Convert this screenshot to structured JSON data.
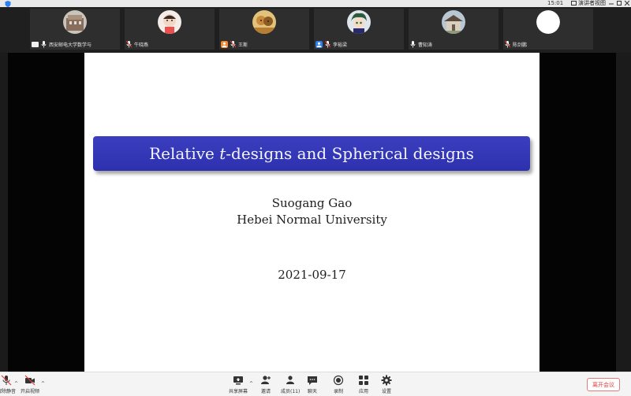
{
  "window": {
    "time": "15:01",
    "view_label": "演讲者视图"
  },
  "participants": [
    {
      "name": "西安邮电大学数学与",
      "mic": "on",
      "icon": "screen-share-icon"
    },
    {
      "name": "牛晓燕",
      "mic": "muted",
      "icon": ""
    },
    {
      "name": "王斯",
      "mic": "muted",
      "icon": "host-icon"
    },
    {
      "name": "李裕梁",
      "mic": "muted",
      "icon": "cohost-icon"
    },
    {
      "name": "曹知涛",
      "mic": "on",
      "icon": ""
    },
    {
      "name": "陈剑鹏",
      "mic": "muted",
      "icon": ""
    }
  ],
  "slide": {
    "title": "Relative t-designs and Spherical designs",
    "author": "Suogang Gao",
    "affiliation": "Hebei Normal University",
    "date": "2021-09-17",
    "title_color": "#3336b4"
  },
  "toolbar": {
    "mute": "解除静音",
    "video": "开启视频",
    "share": "共享屏幕",
    "invite": "邀请",
    "members": "成员(11)",
    "chat": "聊天",
    "record": "录制",
    "apps": "应用",
    "settings": "设置",
    "end": "离开会议"
  },
  "colors": {
    "accent": "#2f80ed",
    "end_red": "#e03c3c",
    "host_orange": "#f28b30"
  }
}
